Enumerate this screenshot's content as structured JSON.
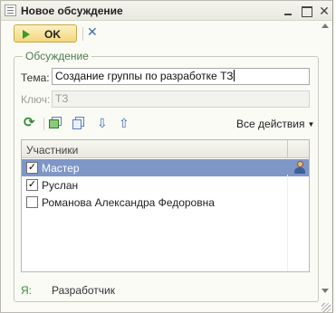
{
  "window": {
    "title": "Новое обсуждение",
    "close_glyph": "✕"
  },
  "toolbar": {
    "ok_label": "OK",
    "cancel_glyph": "✕"
  },
  "group": {
    "legend": "Обсуждение",
    "tema_label": "Тема:",
    "tema_value": "Создание группы по разработке ТЗ",
    "klyuch_label": "Ключ:",
    "klyuch_value": "ТЗ"
  },
  "actions": {
    "refresh_glyph": "⟳",
    "down_glyph": "⇩",
    "up_glyph": "⇧",
    "all_actions_label": "Все действия",
    "all_actions_arrow": "▼"
  },
  "participants": {
    "header": "Участники",
    "rows": [
      {
        "name": "Мастер",
        "checked": true,
        "check_glyph": "✓",
        "selected": true
      },
      {
        "name": "Руслан",
        "checked": true,
        "check_glyph": "✓",
        "selected": false
      },
      {
        "name": "Романова Александра Федоровна",
        "checked": false,
        "check_glyph": "",
        "selected": false
      }
    ]
  },
  "me": {
    "label": "Я:",
    "value": "Разработчик"
  },
  "colors": {
    "selection": "#7f97c7",
    "ok_button": "#f3d77c",
    "green_label": "#3a8a3a",
    "blue_icon": "#3b6db5"
  }
}
